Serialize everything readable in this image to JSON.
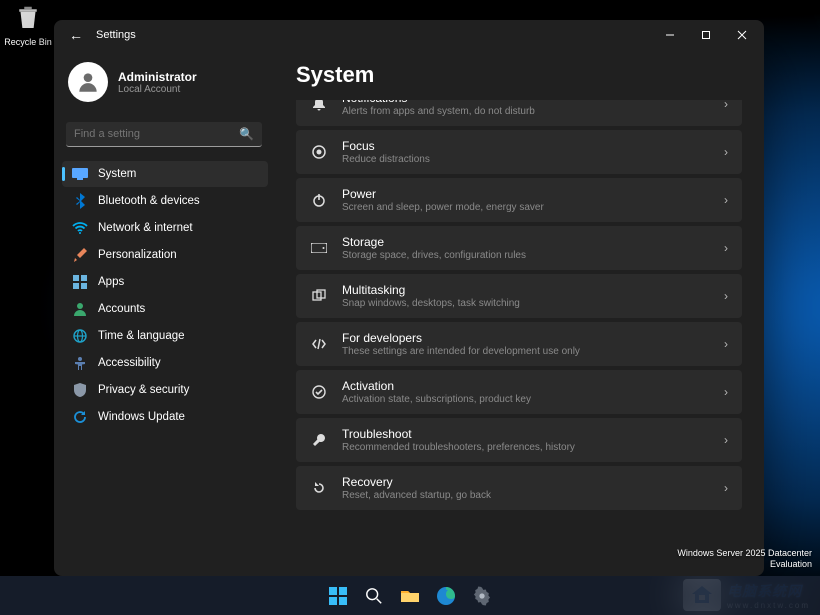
{
  "desktop": {
    "recycle_bin": "Recycle Bin"
  },
  "window": {
    "title": "Settings",
    "user": {
      "name": "Administrator",
      "sub": "Local Account"
    },
    "search_placeholder": "Find a setting",
    "nav": [
      {
        "label": "System",
        "active": true,
        "icon": "display"
      },
      {
        "label": "Bluetooth & devices",
        "active": false,
        "icon": "bluetooth"
      },
      {
        "label": "Network & internet",
        "active": false,
        "icon": "wifi"
      },
      {
        "label": "Personalization",
        "active": false,
        "icon": "brush"
      },
      {
        "label": "Apps",
        "active": false,
        "icon": "apps"
      },
      {
        "label": "Accounts",
        "active": false,
        "icon": "person"
      },
      {
        "label": "Time & language",
        "active": false,
        "icon": "globe"
      },
      {
        "label": "Accessibility",
        "active": false,
        "icon": "access"
      },
      {
        "label": "Privacy & security",
        "active": false,
        "icon": "shield"
      },
      {
        "label": "Windows Update",
        "active": false,
        "icon": "update"
      }
    ],
    "page_title": "System",
    "cards": [
      {
        "title": "Notifications",
        "sub": "Alerts from apps and system, do not disturb",
        "icon": "bell",
        "cut": true
      },
      {
        "title": "Focus",
        "sub": "Reduce distractions",
        "icon": "focus"
      },
      {
        "title": "Power",
        "sub": "Screen and sleep, power mode, energy saver",
        "icon": "power"
      },
      {
        "title": "Storage",
        "sub": "Storage space, drives, configuration rules",
        "icon": "storage"
      },
      {
        "title": "Multitasking",
        "sub": "Snap windows, desktops, task switching",
        "icon": "multitask"
      },
      {
        "title": "For developers",
        "sub": "These settings are intended for development use only",
        "icon": "dev"
      },
      {
        "title": "Activation",
        "sub": "Activation state, subscriptions, product key",
        "icon": "activation"
      },
      {
        "title": "Troubleshoot",
        "sub": "Recommended troubleshooters, preferences, history",
        "icon": "troubleshoot"
      },
      {
        "title": "Recovery",
        "sub": "Reset, advanced startup, go back",
        "icon": "recovery"
      }
    ],
    "overlay_info": {
      "line1": "Windows Server 2025 Datacenter",
      "line2": "Evaluation"
    }
  },
  "watermark": {
    "text": "电脑系统网",
    "url": "www.dnxtw.com"
  },
  "icon_colors": {
    "display": "#58a6ff",
    "bluetooth": "#0078d4",
    "wifi": "#00b0f0",
    "brush": "#e8855a",
    "apps": "#6bb5e0",
    "person": "#3aa76d",
    "globe": "#1fa2c9",
    "access": "#5b7fb1",
    "shield": "#8b98a8",
    "update": "#1b90d8"
  }
}
